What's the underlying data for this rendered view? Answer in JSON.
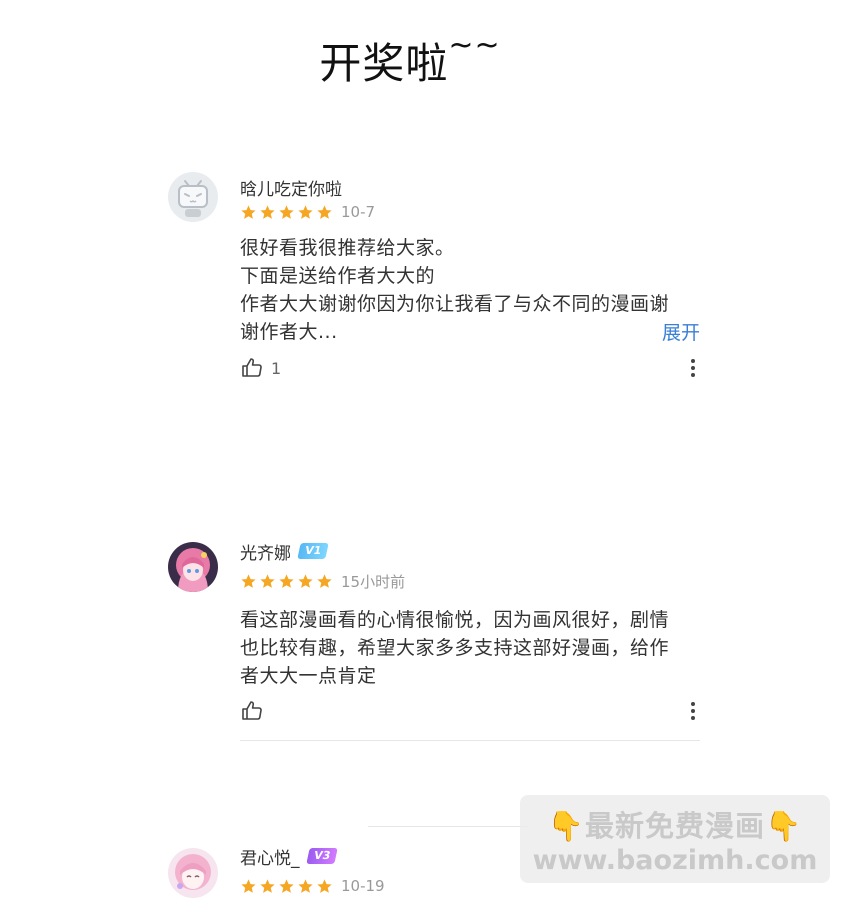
{
  "title": {
    "text": "开奖啦",
    "suffix": "~~"
  },
  "comments": [
    {
      "username": "晗儿吃定你啦",
      "badge": "",
      "stars": 5,
      "date": "10-7",
      "lines": [
        "很好看我很推荐给大家。",
        "下面是送给作者大大的",
        "作者大大谢谢你因为你让我看了与众不同的漫画谢",
        "谢作者大..."
      ],
      "expand_label": "展开",
      "likes": "1",
      "avatar": "bilibili-tv-default-avatar"
    },
    {
      "username": "光齐娜",
      "badge": "V1",
      "stars": 5,
      "date": "15小时前",
      "lines": [
        "看这部漫画看的心情很愉悦，因为画风很好，剧情",
        "也比较有趣，希望大家多多支持这部好漫画，给作",
        "者大大一点肯定"
      ],
      "likes": "",
      "avatar": "anime-girl-pink-hair-avatar"
    },
    {
      "username": "君心悦_",
      "badge": "V3",
      "stars": 5,
      "date": "10-19",
      "avatar": "anime-girl-pink-avatar"
    }
  ],
  "watermark": {
    "line1": "最新免费漫画",
    "hand": "👇",
    "line2": "www.baozimh.com"
  },
  "colors": {
    "star": "#f5a623",
    "link": "#3a7fd5",
    "badge_v1": "#56b8f5",
    "badge_v3": "#a95ef2"
  }
}
